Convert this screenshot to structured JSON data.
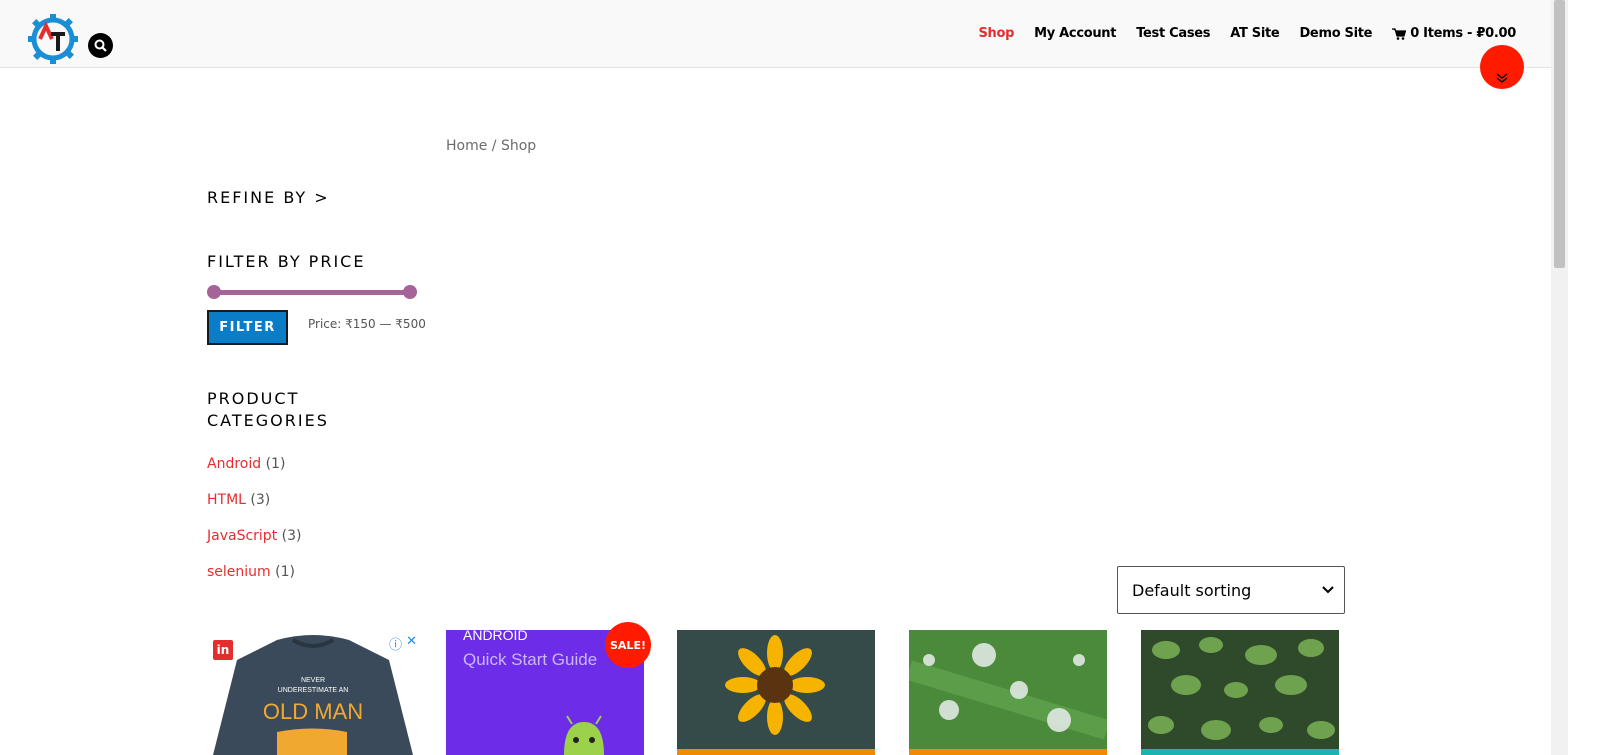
{
  "header": {
    "nav": [
      {
        "label": "Shop",
        "active": true
      },
      {
        "label": "My Account",
        "active": false
      },
      {
        "label": "Test Cases",
        "active": false
      },
      {
        "label": "AT Site",
        "active": false
      },
      {
        "label": "Demo Site",
        "active": false
      }
    ],
    "cart_label": "0 Items - ₽0.00"
  },
  "breadcrumb": {
    "home": "Home",
    "sep": " / ",
    "current": "Shop"
  },
  "sidebar": {
    "refine_title": "REFINE BY >",
    "price_title": "FILTER BY PRICE",
    "filter_button": "FILTER",
    "price_text": "Price: ₹150 — ₹500",
    "categories_title": "PRODUCT CATEGORIES",
    "categories": [
      {
        "name": "Android",
        "count": "(1)"
      },
      {
        "name": "HTML",
        "count": "(3)"
      },
      {
        "name": "JavaScript",
        "count": "(3)"
      },
      {
        "name": "selenium",
        "count": "(1)"
      }
    ]
  },
  "sorting": {
    "selected": "Default sorting"
  },
  "ad": {
    "logo_text": "in",
    "shirt_line1": "NEVER",
    "shirt_line2": "UNDERESTIMATE AN",
    "shirt_line3": "OLD MAN"
  },
  "products": {
    "p1_title1": "ANDROID",
    "p1_title2": "Quick Start Guide",
    "sale_badge": "SALE!"
  },
  "colors": {
    "accent_red": "#e62d2d",
    "slider": "#a46497",
    "filter_button": "#0a7dc8",
    "sale_badge": "#ff1a00"
  }
}
